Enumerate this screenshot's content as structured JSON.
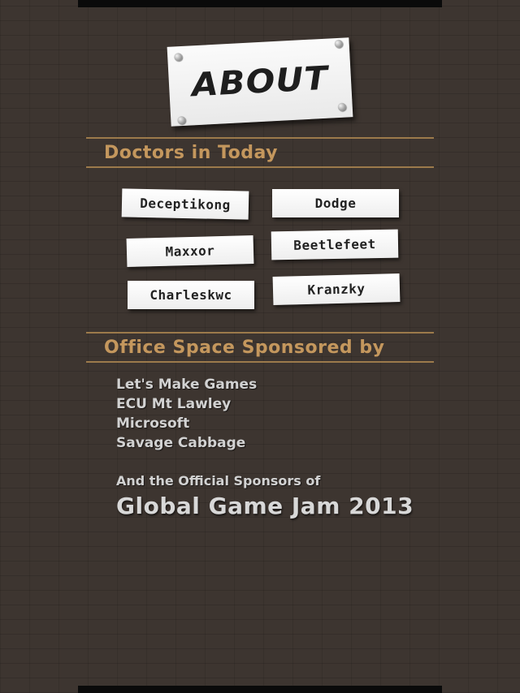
{
  "title": "ABOUT",
  "doctors": {
    "heading": "Doctors in Today",
    "names": [
      "Deceptikong",
      "Dodge",
      "Maxxor",
      "Beetlefeet",
      "Charleskwc",
      "Kranzky"
    ]
  },
  "sponsors": {
    "heading": "Office Space Sponsored by",
    "list": [
      "Let's Make Games",
      "ECU Mt Lawley",
      "Microsoft",
      "Savage Cabbage"
    ],
    "official_line": "And the Official Sponsors of",
    "event": "Global Game Jam 2013"
  },
  "colors": {
    "background": "#3d3530",
    "accent": "#c4975d",
    "rule": "#9c7a4b",
    "text": "#d2d2d2"
  }
}
